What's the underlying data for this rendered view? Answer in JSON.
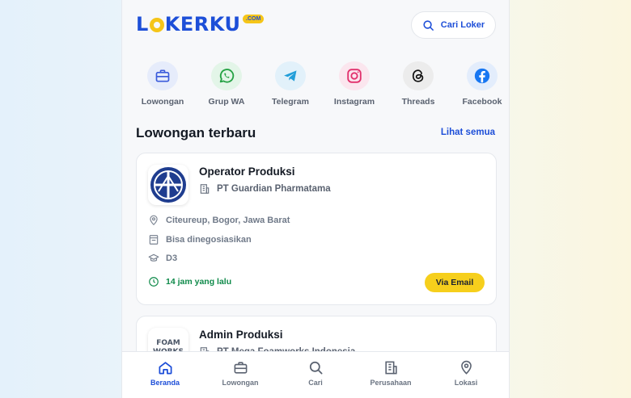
{
  "header": {
    "logo_text": "LOKERKU",
    "logo_badge": ".COM",
    "search_label": "Cari Loker"
  },
  "social": [
    {
      "label": "Lowongan",
      "icon": "briefcase-icon",
      "color": "#3b5bdb",
      "bg": "#e6ecfb"
    },
    {
      "label": "Grup WA",
      "icon": "whatsapp-icon",
      "color": "#25a244",
      "bg": "#e3f5e8"
    },
    {
      "label": "Telegram",
      "icon": "telegram-icon",
      "color": "#229ed9",
      "bg": "#e2f1fa"
    },
    {
      "label": "Instagram",
      "icon": "instagram-icon",
      "color": "#e1306c",
      "bg": "#fbe6ee"
    },
    {
      "label": "Threads",
      "icon": "threads-icon",
      "color": "#111111",
      "bg": "#ececec"
    },
    {
      "label": "Facebook",
      "icon": "facebook-icon",
      "color": "#1877f2",
      "bg": "#e3edfc"
    }
  ],
  "section": {
    "title": "Lowongan terbaru",
    "see_all": "Lihat semua"
  },
  "jobs": [
    {
      "title": "Operator Produksi",
      "company": "PT Guardian Pharmatama",
      "location": "Citeureup, Bogor, Jawa Barat",
      "salary": "Bisa dinegosiasikan",
      "education": "D3",
      "posted": "14 jam yang lalu",
      "apply_label": "Via Email"
    },
    {
      "title": "Admin Produksi",
      "company": "PT Mega Foamworks Indonesia",
      "logo_text": "FOAM WORKS"
    }
  ],
  "bottom_nav": [
    {
      "label": "Beranda",
      "icon": "home-icon",
      "active": true
    },
    {
      "label": "Lowongan",
      "icon": "briefcase-icon",
      "active": false
    },
    {
      "label": "Cari",
      "icon": "search-icon",
      "active": false
    },
    {
      "label": "Perusahaan",
      "icon": "building-icon",
      "active": false
    },
    {
      "label": "Lokasi",
      "icon": "location-pin-icon",
      "active": false
    }
  ],
  "colors": {
    "primary": "#1d4ed8",
    "accent": "#f6cf1c",
    "success": "#0f8a4a"
  }
}
